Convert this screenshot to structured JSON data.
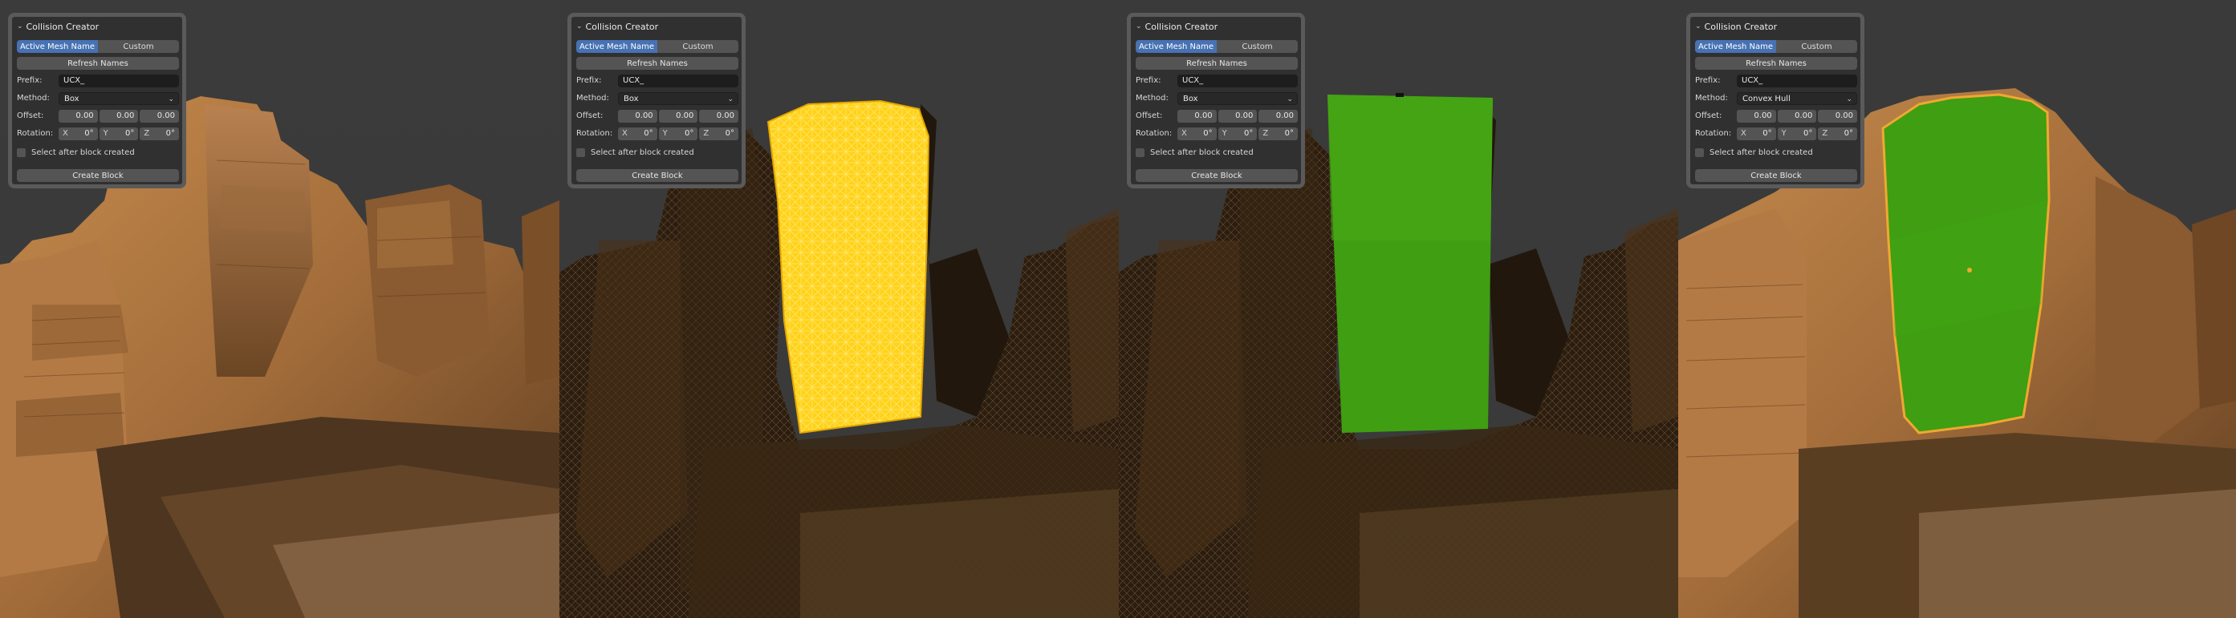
{
  "panels": [
    {
      "title": "Collision Creator",
      "mode_options": [
        "Active Mesh Name",
        "Custom"
      ],
      "active_mode": "Active Mesh Name",
      "refresh_label": "Refresh Names",
      "prefix_label": "Prefix:",
      "prefix_value": "UCX_",
      "method_label": "Method:",
      "method_value": "Box",
      "offset_label": "Offset:",
      "offset_values": [
        "0.00",
        "0.00",
        "0.00"
      ],
      "rotation_label": "Rotation:",
      "rotation_axes": [
        "X",
        "Y",
        "Z"
      ],
      "rotation_values": [
        "0°",
        "0°",
        "0°"
      ],
      "select_after_label": "Select after block created",
      "select_after_checked": false,
      "create_label": "Create Block"
    },
    {
      "title": "Collision Creator",
      "mode_options": [
        "Active Mesh Name",
        "Custom"
      ],
      "active_mode": "Active Mesh Name",
      "refresh_label": "Refresh Names",
      "prefix_label": "Prefix:",
      "prefix_value": "UCX_",
      "method_label": "Method:",
      "method_value": "Box",
      "offset_label": "Offset:",
      "offset_values": [
        "0.00",
        "0.00",
        "0.00"
      ],
      "rotation_label": "Rotation:",
      "rotation_axes": [
        "X",
        "Y",
        "Z"
      ],
      "rotation_values": [
        "0°",
        "0°",
        "0°"
      ],
      "select_after_label": "Select after block created",
      "select_after_checked": false,
      "create_label": "Create Block"
    },
    {
      "title": "Collision Creator",
      "mode_options": [
        "Active Mesh Name",
        "Custom"
      ],
      "active_mode": "Active Mesh Name",
      "refresh_label": "Refresh Names",
      "prefix_label": "Prefix:",
      "prefix_value": "UCX_",
      "method_label": "Method:",
      "method_value": "Box",
      "offset_label": "Offset:",
      "offset_values": [
        "0.00",
        "0.00",
        "0.00"
      ],
      "rotation_label": "Rotation:",
      "rotation_axes": [
        "X",
        "Y",
        "Z"
      ],
      "rotation_values": [
        "0°",
        "0°",
        "0°"
      ],
      "select_after_label": "Select after block created",
      "select_after_checked": false,
      "create_label": "Create Block"
    },
    {
      "title": "Collision Creator",
      "mode_options": [
        "Active Mesh Name",
        "Custom"
      ],
      "active_mode": "Active Mesh Name",
      "refresh_label": "Refresh Names",
      "prefix_label": "Prefix:",
      "prefix_value": "UCX_",
      "method_label": "Method:",
      "method_value": "Convex Hull",
      "offset_label": "Offset:",
      "offset_values": [
        "0.00",
        "0.00",
        "0.00"
      ],
      "rotation_label": "Rotation:",
      "rotation_axes": [
        "X",
        "Y",
        "Z"
      ],
      "rotation_values": [
        "0°",
        "0°",
        "0°"
      ],
      "select_after_label": "Select after block created",
      "select_after_checked": false,
      "create_label": "Create Block"
    }
  ],
  "viewports": [
    {
      "content": "textured-ruin",
      "collision_display": "none"
    },
    {
      "content": "wireframe-ruin",
      "collision_display": "yellow-wireframe-block"
    },
    {
      "content": "wireframe-ruin",
      "collision_display": "green-box-block"
    },
    {
      "content": "textured-ruin",
      "collision_display": "green-convex-hull"
    }
  ],
  "colors": {
    "panel_bg": "#303030",
    "panel_border": "#5a5a5a",
    "active_accent": "#4772b3",
    "button_bg": "#545454",
    "field_bg": "#1d1d1d",
    "collision_green": "#3f9e12",
    "wire_yellow": "#ffd21a",
    "stone_brown": "#9a6a3a"
  }
}
